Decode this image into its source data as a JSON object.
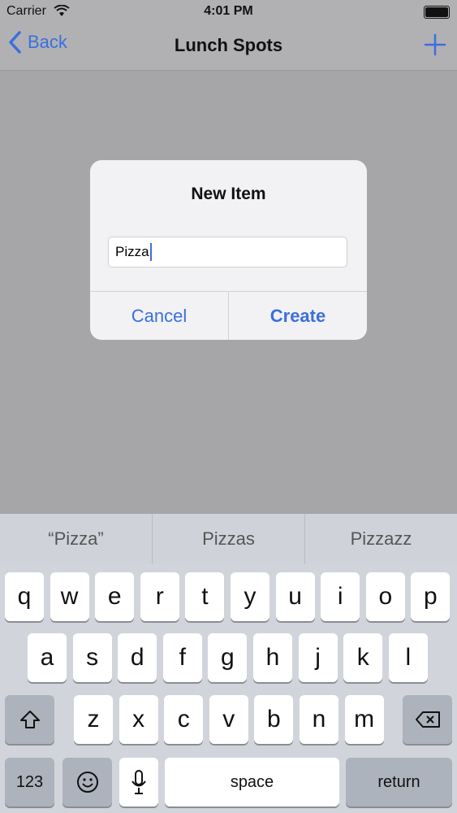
{
  "status_bar": {
    "carrier": "Carrier",
    "time": "4:01 PM"
  },
  "nav_bar": {
    "back_label": "Back",
    "title": "Lunch Spots",
    "add_icon": "plus-icon"
  },
  "alert": {
    "title": "New Item",
    "input_value": "Pizza",
    "cancel_label": "Cancel",
    "create_label": "Create"
  },
  "suggestions": [
    "“Pizza”",
    "Pizzas",
    "Pizzazz"
  ],
  "keyboard": {
    "row1": [
      "q",
      "w",
      "e",
      "r",
      "t",
      "y",
      "u",
      "i",
      "o",
      "p"
    ],
    "row2": [
      "a",
      "s",
      "d",
      "f",
      "g",
      "h",
      "j",
      "k",
      "l"
    ],
    "row3": [
      "z",
      "x",
      "c",
      "v",
      "b",
      "n",
      "m"
    ],
    "numbers_label": "123",
    "space_label": "space",
    "return_label": "return"
  },
  "colors": {
    "accent": "#3b6fe0",
    "overlay": "#a6a6a9"
  }
}
